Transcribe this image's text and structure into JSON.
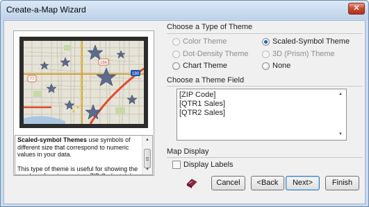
{
  "window": {
    "title": "Create-a-Map Wizard",
    "close_glyph": "✕"
  },
  "preview": {
    "description": [
      {
        "bold": "Scaled-symbol Themes",
        "text": " use symbols of different size that correspond to numeric values in your data."
      },
      {
        "bold": "",
        "text": "This type of theme is useful for showing the number of customers in a ZIP Code, total sales by store, or total exports by country."
      }
    ],
    "map_shields": [
      "77",
      "166",
      "190"
    ]
  },
  "theme_type": {
    "title": "Choose a Type of Theme",
    "options": [
      {
        "label": "Color Theme",
        "checked": false,
        "enabled": false
      },
      {
        "label": "Scaled-Symbol Theme",
        "checked": true,
        "enabled": true
      },
      {
        "label": "Dot-Density Theme",
        "checked": false,
        "enabled": false
      },
      {
        "label": "3D (Prism) Theme",
        "checked": false,
        "enabled": false
      },
      {
        "label": "Chart Theme",
        "checked": false,
        "enabled": true
      },
      {
        "label": "None",
        "checked": false,
        "enabled": true
      }
    ]
  },
  "theme_field": {
    "title": "Choose a Theme Field",
    "items": [
      "[ZIP Code]",
      "[QTR1 Sales]",
      "[QTR2 Sales]"
    ]
  },
  "map_display": {
    "title": "Map Display",
    "display_labels": {
      "label": "Display Labels",
      "checked": false
    }
  },
  "buttons": {
    "help_icon": "help-book-icon",
    "cancel": "Cancel",
    "back": "<Back",
    "next": "Next>",
    "finish": "Finish"
  },
  "colors": {
    "title_bar": "#bed2ea",
    "dialog_bg": "#f0f0f0",
    "close_button": "#c7482f",
    "radio_selected": "#1c5fbf",
    "map_star": "#5b6a8d"
  }
}
